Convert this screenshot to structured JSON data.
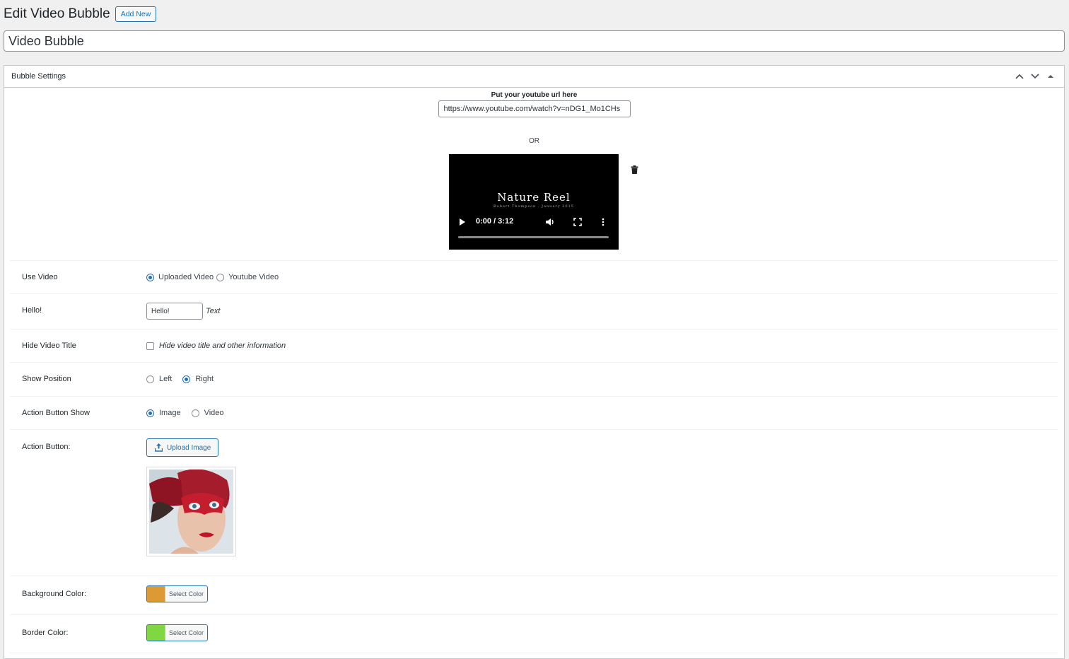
{
  "header": {
    "title": "Edit Video Bubble",
    "add_new_label": "Add New"
  },
  "post_title": "Video Bubble",
  "metabox": {
    "title": "Bubble Settings",
    "youtube_label": "Put your youtube url here",
    "youtube_value": "https://www.youtube.com/watch?v=nDG1_Mo1CHs",
    "or_text": "OR",
    "video": {
      "title": "Nature Reel",
      "subtitle": "Robert Thompson · January 2015",
      "time": "0:00 / 3:12",
      "progress": 0
    }
  },
  "settings": {
    "use_video": {
      "label": "Use Video",
      "options": [
        "Uploaded Video",
        "Youtube Video"
      ],
      "selected": 0
    },
    "hello": {
      "label": "Hello!",
      "value": "Hello!",
      "hint": "Text"
    },
    "hide_title": {
      "label": "Hide Video Title",
      "hint": "Hide video title and other information",
      "checked": false
    },
    "show_position": {
      "label": "Show Position",
      "options": [
        "Left",
        "Right"
      ],
      "selected": 1
    },
    "action_show": {
      "label": "Action Button Show",
      "options": [
        "Image",
        "Video"
      ],
      "selected": 0
    },
    "action_button": {
      "label": "Action Button:",
      "upload_label": "Upload Image"
    },
    "bg_color": {
      "label": "Background Color:",
      "button_label": "Select Color",
      "color": "#dd9933"
    },
    "border_color": {
      "label": "Border Color:",
      "button_label": "Select Color",
      "color": "#81d742"
    }
  },
  "colors": {
    "accent": "#2271b1",
    "background": "#f0f0f1"
  }
}
